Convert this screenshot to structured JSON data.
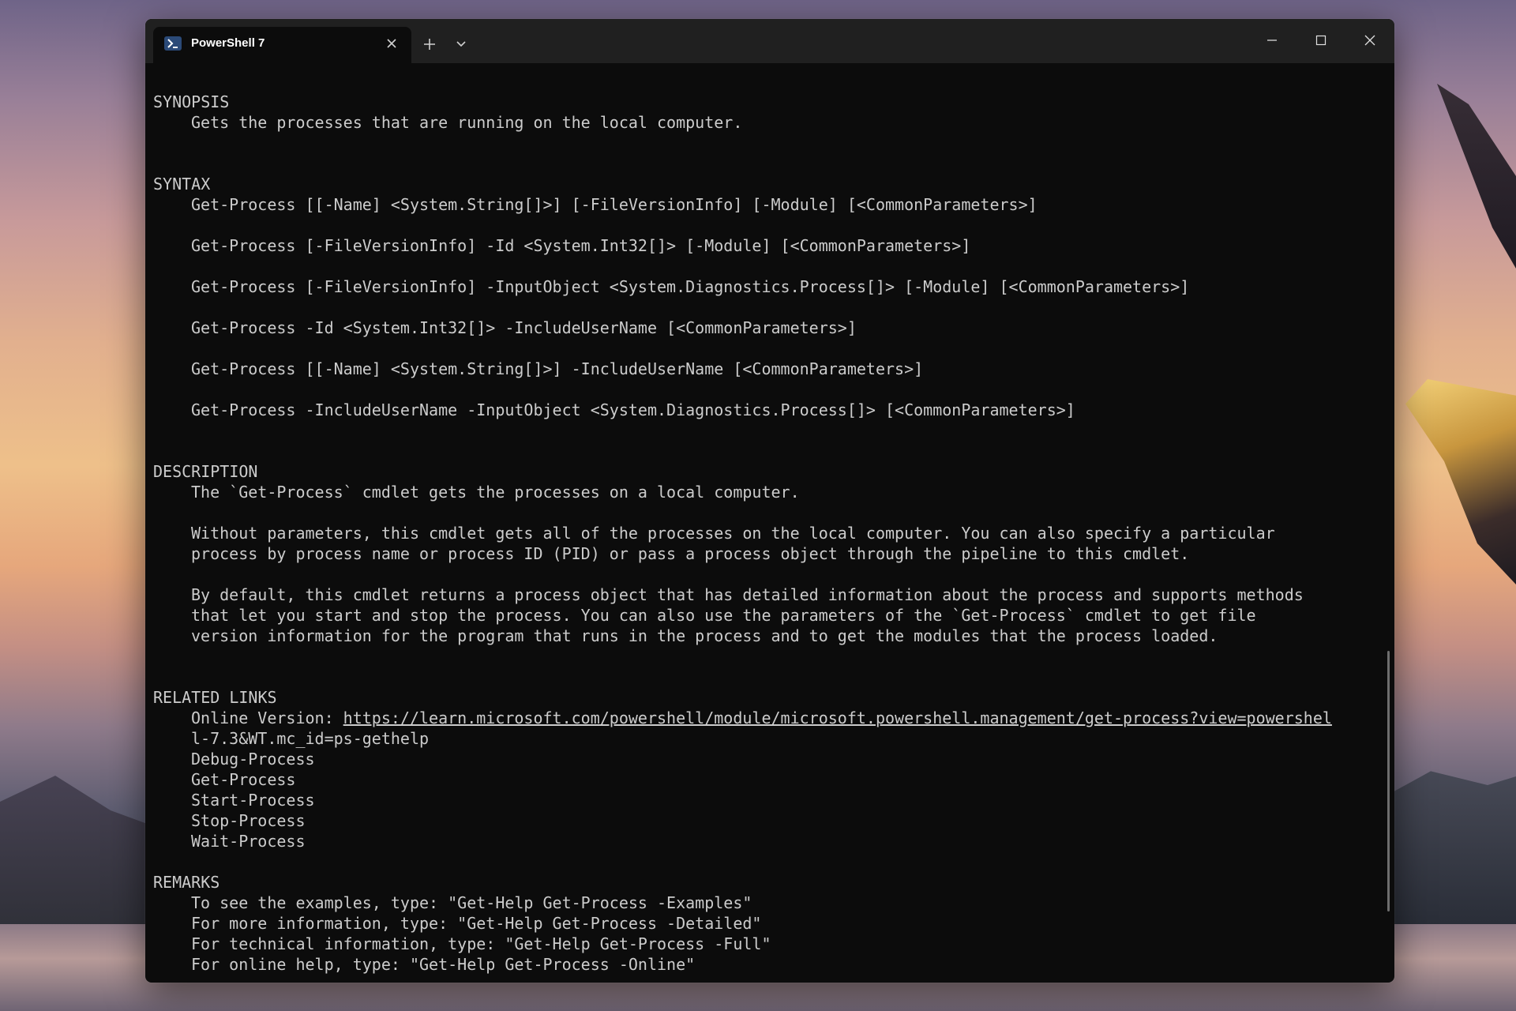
{
  "window": {
    "tab_title": "PowerShell 7"
  },
  "help": {
    "synopsis": {
      "heading": "SYNOPSIS",
      "text": "Gets the processes that are running on the local computer."
    },
    "syntax": {
      "heading": "SYNTAX",
      "lines": [
        "Get-Process [[-Name] <System.String[]>] [-FileVersionInfo] [-Module] [<CommonParameters>]",
        "Get-Process [-FileVersionInfo] -Id <System.Int32[]> [-Module] [<CommonParameters>]",
        "Get-Process [-FileVersionInfo] -InputObject <System.Diagnostics.Process[]> [-Module] [<CommonParameters>]",
        "Get-Process -Id <System.Int32[]> -IncludeUserName [<CommonParameters>]",
        "Get-Process [[-Name] <System.String[]>] -IncludeUserName [<CommonParameters>]",
        "Get-Process -IncludeUserName -InputObject <System.Diagnostics.Process[]> [<CommonParameters>]"
      ]
    },
    "description": {
      "heading": "DESCRIPTION",
      "p1": "The `Get-Process` cmdlet gets the processes on a local computer.",
      "p2_line1": "Without parameters, this cmdlet gets all of the processes on the local computer. You can also specify a particular",
      "p2_line2": "process by process name or process ID (PID) or pass a process object through the pipeline to this cmdlet.",
      "p3_line1": "By default, this cmdlet returns a process object that has detailed information about the process and supports methods",
      "p3_line2": "that let you start and stop the process. You can also use the parameters of the `Get-Process` cmdlet to get file",
      "p3_line3": "version information for the program that runs in the process and to get the modules that the process loaded."
    },
    "related_links": {
      "heading": "RELATED LINKS",
      "online_label": "Online Version: ",
      "online_url_line1": "https://learn.microsoft.com/powershell/module/microsoft.powershell.management/get-process?view=powershel",
      "online_url_line2": "l-7.3&WT.mc_id=ps-gethelp",
      "items": [
        "Debug-Process",
        "Get-Process",
        "Start-Process",
        "Stop-Process",
        "Wait-Process"
      ]
    },
    "remarks": {
      "heading": "REMARKS",
      "lines": [
        "To see the examples, type: \"Get-Help Get-Process -Examples\"",
        "For more information, type: \"Get-Help Get-Process -Detailed\"",
        "For technical information, type: \"Get-Help Get-Process -Full\"",
        "For online help, type: \"Get-Help Get-Process -Online\""
      ]
    }
  },
  "icons": {
    "tab_icon": "powershell-icon",
    "tab_close": "close-icon",
    "new_tab": "plus-icon",
    "dropdown": "chevron-down-icon",
    "minimize": "minimize-icon",
    "maximize": "maximize-icon",
    "close": "close-icon"
  }
}
